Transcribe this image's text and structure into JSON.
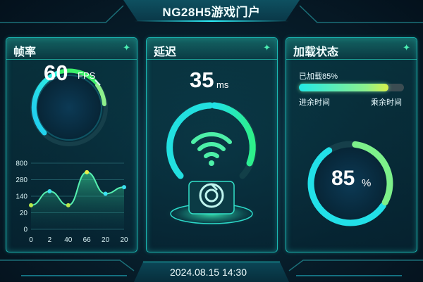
{
  "header": {
    "title": "NG28H5游戏门户"
  },
  "fps_panel": {
    "title": "帧率",
    "value": "60",
    "unit": "FPS",
    "gauge_fraction": 0.6,
    "sparkle_icon": "sparkle-icon"
  },
  "latency_panel": {
    "title": "延迟",
    "value": "35",
    "unit": "ms",
    "icons": [
      "wifi-icon",
      "game-logo-icon"
    ]
  },
  "loading_panel": {
    "title": "加载状态",
    "status_text": "已加载85%",
    "progress": 0.85,
    "left_label": "进余时间",
    "right_label": "乘余时间",
    "ring_value": "85",
    "ring_unit": "%"
  },
  "chart_data": {
    "type": "area",
    "categories": [
      "0",
      "2",
      "40",
      "66",
      "20",
      "20"
    ],
    "values": [
      290,
      460,
      290,
      690,
      430,
      510
    ],
    "ylim": [
      0,
      800
    ],
    "y_ticks": [
      "800",
      "280",
      "140",
      "20",
      "0"
    ],
    "grid": true
  },
  "footer": {
    "datetime": "2024.08.15 14:30"
  },
  "colors": {
    "accent_cyan": "#22e8e6",
    "accent_green": "#8df08c",
    "accent_yellow": "#d8f04a",
    "panel_border": "#1bb9b4"
  }
}
